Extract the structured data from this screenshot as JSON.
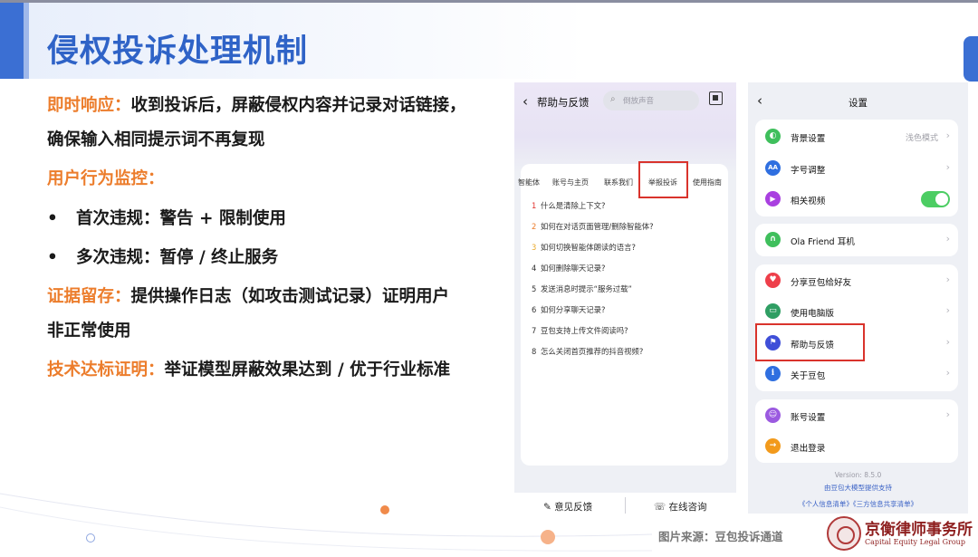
{
  "slide": {
    "title": "侵权投诉处理机制",
    "points": [
      {
        "label": "即时响应：",
        "text": "收到投诉后，屏蔽侵权内容并记录对话链接，"
      },
      {
        "text": "确保输入相同提示词不再复现"
      },
      {
        "label": "用户行为监控："
      },
      {
        "bullet": "•",
        "text": "首次违规：警告 + 限制使用"
      },
      {
        "bullet": "•",
        "text": "多次违规：暂停 / 终止服务"
      },
      {
        "label": "证据留存：",
        "text": "提供操作日志（如攻击测试记录）证明用户"
      },
      {
        "text": "非正常使用"
      },
      {
        "label": "技术达标证明：",
        "text": "举证模型屏蔽效果达到 / 优于行业标准"
      }
    ],
    "source_note": "图片来源：豆包投诉通道",
    "logo_cn": "京衡律师事务所",
    "logo_en": "Capital Equity Legal Group",
    "colors": {
      "title": "#2f63c7",
      "accent": "#ec7d2c",
      "highlight": "#d9332c"
    }
  },
  "help_screen": {
    "back_icon": "chevron-left-icon",
    "title": "帮助与反馈",
    "search_placeholder": "倒放声音",
    "tabs": [
      "智能体",
      "账号与主页",
      "联系我们",
      "举报投诉",
      "使用指南"
    ],
    "highlighted_tab": "举报投诉",
    "faqs": [
      {
        "num": "1",
        "text": "什么是清除上下文?"
      },
      {
        "num": "2",
        "text": "如何在对话页面管理/删除智能体?"
      },
      {
        "num": "3",
        "text": "如何切换智能体朗读的语言?"
      },
      {
        "num": "4",
        "text": "如何删除聊天记录?"
      },
      {
        "num": "5",
        "text": "发送消息时提示“服务过载”"
      },
      {
        "num": "6",
        "text": "如何分享聊天记录?"
      },
      {
        "num": "7",
        "text": "豆包支持上传文件阅读吗?"
      },
      {
        "num": "8",
        "text": "怎么关闭首页推荐的抖音视频?"
      }
    ],
    "bottom_buttons": [
      {
        "icon": "edit-icon",
        "glyph": "✎",
        "label": "意见反馈"
      },
      {
        "icon": "headset-icon",
        "glyph": "☏",
        "label": "在线咨询"
      }
    ]
  },
  "settings_screen": {
    "title": "设置",
    "groups": [
      [
        {
          "icon": "theme-icon",
          "label": "背景设置",
          "value": "浅色模式",
          "color": "#3fbf5c",
          "glyph": "◐"
        },
        {
          "icon": "font-size-icon",
          "label": "字号调整",
          "color": "#2f6fe0",
          "glyph": "AA"
        },
        {
          "icon": "video-icon",
          "label": "相关视频",
          "toggle": true,
          "color": "#a940e0",
          "glyph": "▶"
        }
      ],
      [
        {
          "icon": "earphone-icon",
          "label": "Ola Friend 耳机",
          "color": "#3fbf5c",
          "glyph": "∩"
        }
      ],
      [
        {
          "icon": "heart-icon",
          "label": "分享豆包给好友",
          "color": "#ee3f4a",
          "glyph": "♥"
        },
        {
          "icon": "desktop-icon",
          "label": "使用电脑版",
          "color": "#2f9e63",
          "glyph": "▭"
        },
        {
          "icon": "flag-icon",
          "label": "帮助与反馈",
          "color": "#3f4fd8",
          "glyph": "⚑",
          "highlight": true
        },
        {
          "icon": "info-icon",
          "label": "关于豆包",
          "color": "#2f6fe0",
          "glyph": "i"
        }
      ],
      [
        {
          "icon": "account-icon",
          "label": "账号设置",
          "color": "#9b5ae0",
          "glyph": "☺"
        },
        {
          "icon": "logout-icon",
          "label": "退出登录",
          "color": "#f29a1c",
          "glyph": "→"
        }
      ]
    ],
    "version": "Version: 8.5.0",
    "provider": "由豆包大模型提供支持",
    "policy_links": "《个人信息清单》《三方信息共享清单》"
  }
}
